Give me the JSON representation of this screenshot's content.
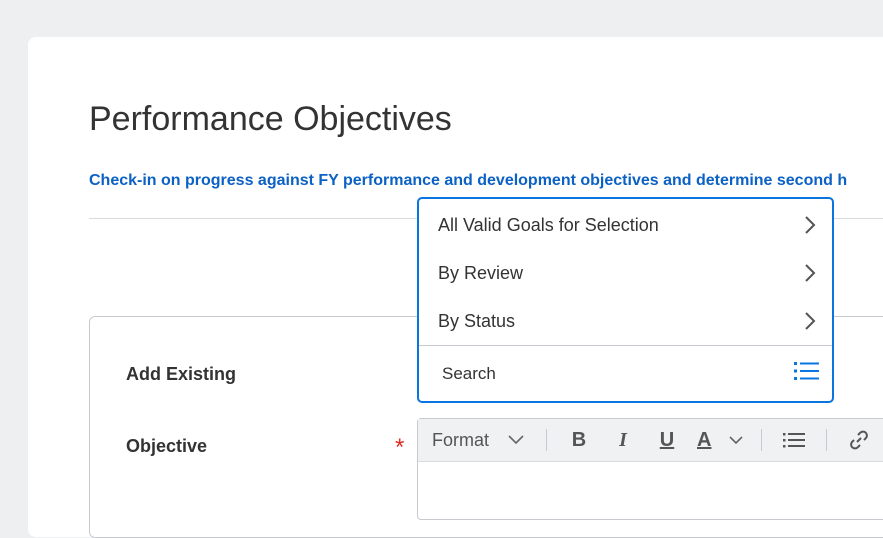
{
  "page": {
    "title": "Performance Objectives",
    "subtitle": "Check-in on progress against FY performance and development objectives and determine second h"
  },
  "form": {
    "add_existing_label": "Add Existing",
    "objective_label": "Objective",
    "required_marker": "*"
  },
  "dropdown": {
    "items": [
      {
        "label": "All Valid Goals for Selection",
        "icon": "chevron-right-icon"
      },
      {
        "label": "By Review",
        "icon": "chevron-right-icon"
      },
      {
        "label": "By Status",
        "icon": "chevron-right-icon"
      }
    ],
    "search_placeholder": "Search",
    "list_icon": "list-icon"
  },
  "editor_toolbar": {
    "format_label": "Format",
    "bold": "B",
    "italic": "I",
    "underline": "U",
    "font_color": "A"
  },
  "colors": {
    "accent": "#0875e1",
    "link": "#0b61c4",
    "required": "#de2e21",
    "background": "#edeff1"
  }
}
